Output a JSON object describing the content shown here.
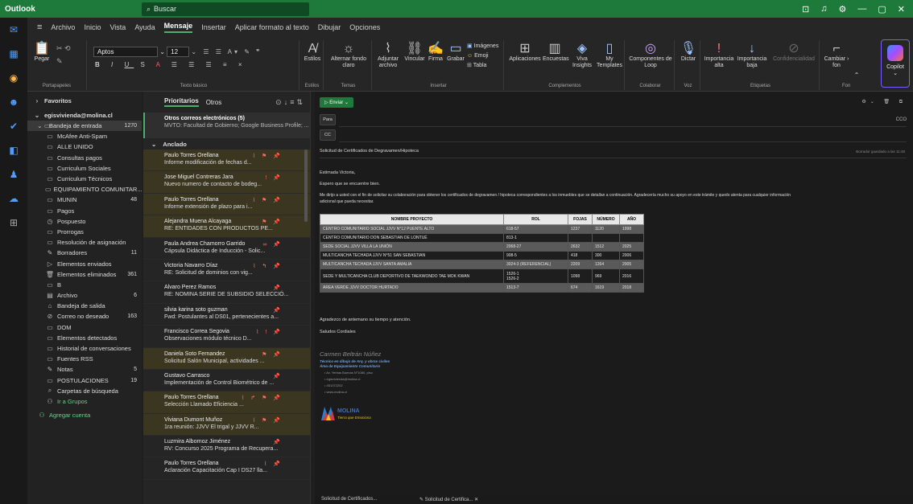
{
  "app": {
    "title": "Outlook",
    "search_placeholder": "Buscar"
  },
  "menu": [
    "Archivo",
    "Inicio",
    "Vista",
    "Ayuda",
    "Mensaje",
    "Insertar",
    "Aplicar formato al texto",
    "Dibujar",
    "Opciones"
  ],
  "ribbon": {
    "pegar": "Pegar",
    "portapapeles": "Portapapeles",
    "font_name": "Aptos",
    "font_size": "12",
    "texto_basico": "Texto básico",
    "estilos": "Estilos",
    "estilos_cap": "Estilos",
    "alternar1": "Alternar fondo",
    "alternar2": "claro",
    "temas": "Temas",
    "adjuntar1": "Adjuntar",
    "adjuntar2": "archivo",
    "vincular": "Vincular",
    "firma": "Firma",
    "grabar": "Grabar",
    "imagenes": "Imágenes",
    "emoji": "Emoji",
    "tabla": "Tabla",
    "insertar": "Insertar",
    "aplicaciones": "Aplicaciones",
    "encuestas": "Encuestas",
    "viva1": "Viva",
    "viva2": "Insights",
    "my1": "My",
    "my2": "Templates",
    "complementos": "Complementos",
    "loop1": "Componentes de",
    "loop2": "Loop",
    "colaborar": "Colaborar",
    "dictar": "Dictar",
    "voz": "Voz",
    "imp_alta1": "Importancia",
    "imp_alta2": "alta",
    "imp_baja1": "Importancia",
    "imp_baja2": "baja",
    "confidencialidad": "Confidencialidad",
    "etiquetas": "Etiquetas",
    "cambiar1": "Cambiar",
    "cambiar2": "fon",
    "fon_cap": "Fon",
    "copilot": "Copilot"
  },
  "folders": {
    "favoritos": "Favoritos",
    "account": "egisvivienda@molina.cl",
    "items": [
      {
        "label": "Bandeja de entrada",
        "count": "1270"
      },
      {
        "label": "McAfee Anti-Spam",
        "count": ""
      },
      {
        "label": "ALLE UNIDO",
        "count": ""
      },
      {
        "label": "Consultas pagos",
        "count": ""
      },
      {
        "label": "Curriculum Sociales",
        "count": ""
      },
      {
        "label": "Curriculum Técnicos",
        "count": ""
      },
      {
        "label": "EQUIPAMIENTO COMUNITAR...",
        "count": ""
      },
      {
        "label": "MUNIN",
        "count": "48"
      },
      {
        "label": "Pagos",
        "count": ""
      },
      {
        "label": "Pospuesto",
        "count": ""
      },
      {
        "label": "Prorrogas",
        "count": ""
      },
      {
        "label": "Resolución de asignación",
        "count": ""
      },
      {
        "label": "Borradores",
        "count": "11"
      },
      {
        "label": "Elementos enviados",
        "count": ""
      },
      {
        "label": "Elementos eliminados",
        "count": "361"
      },
      {
        "label": "B",
        "count": ""
      },
      {
        "label": "Archivo",
        "count": "6"
      },
      {
        "label": "Bandeja de salida",
        "count": ""
      },
      {
        "label": "Correo no deseado",
        "count": "163"
      },
      {
        "label": "DOM",
        "count": ""
      },
      {
        "label": "Elementos detectados",
        "count": ""
      },
      {
        "label": "Historial de conversaciones",
        "count": ""
      },
      {
        "label": "Fuentes RSS",
        "count": ""
      },
      {
        "label": "Notas",
        "count": "5"
      },
      {
        "label": "POSTULACIONES",
        "count": "19"
      },
      {
        "label": "Carpetas de búsqueda",
        "count": ""
      },
      {
        "label": "Ir a Grupos",
        "count": ""
      }
    ],
    "agregar": "Agregar cuenta"
  },
  "maillist": {
    "tab_prioritarios": "Prioritarios",
    "tab_otros": "Otros",
    "otros_title": "Otros correos electrónicos (5)",
    "otros_sub": "MVTO: Facultad de Gobierno; Google Business Profile; ...",
    "anclado": "Anclado",
    "items": [
      {
        "sender": "Paulo Torres Orellana",
        "subject": "Informe modificación de fechas d...",
        "y": true
      },
      {
        "sender": "Jose Miguel Contreras Jara",
        "subject": "Nuevo numero de contacto de bodeg...",
        "y": true
      },
      {
        "sender": "Paulo Torres Orellana",
        "subject": "Informe extensión de plazo para i...",
        "y": true
      },
      {
        "sender": "Alejandra Muena Alcayaga",
        "subject": "RE: ENTIDADES CON PRODUCTOS PE...",
        "y": true
      },
      {
        "sender": "Paula Andrea Chamorro Garrido",
        "subject": "Cápsula Didáctica de Inducción - Solic...",
        "y": false
      },
      {
        "sender": "Victoria Navarro Díaz",
        "subject": "RE: Solicitud de dominios con vig...",
        "y": false
      },
      {
        "sender": "Alvaro Perez Ramos",
        "subject": "RE: NOMINA SERIE DE SUBSIDIO SELECCIÓ...",
        "y": false
      },
      {
        "sender": "silvia karina soto guzman",
        "subject": "Fwd: Postulantes al DS01, pertenecientes a...",
        "y": false
      },
      {
        "sender": "Francisco Correa Segovia",
        "subject": "Observaciones módulo técnico D...",
        "y": false
      },
      {
        "sender": "Daniela Soto Fernandez",
        "subject": "Solicitud Salón Municipal, actividades ...",
        "y": true
      },
      {
        "sender": "Gustavo Carrasco",
        "subject": "Implementación de Control Biométrico de ...",
        "y": false
      },
      {
        "sender": "Paulo Torres Orellana",
        "subject": "Selección Llamado Eficiencia ...",
        "y": true
      },
      {
        "sender": "Viviana Dumont Muñoz",
        "subject": "1ra reunión: JJVV El trigal y JJVV R...",
        "y": true
      },
      {
        "sender": "Luzmira Albornoz Jiménez",
        "subject": "RV: Concurso 2025 Programa de Recupera...",
        "y": false
      },
      {
        "sender": "Paulo Torres Orellana",
        "subject": "Aclaración Capacitación Cap I DS27 lla...",
        "y": false
      }
    ]
  },
  "compose": {
    "send": "Enviar",
    "para": "Para",
    "cc": "CC",
    "cco": "CCO",
    "subject": "Solicitud de Certificados de Degravamen/Hipoteca",
    "draft_saved": "Borrador guardado a las 11:48",
    "greeting": "Estimada Victoria,",
    "line1": "Espero que se encuentre bien.",
    "line2": "Me dirijo a usted con el fin de solicitar su colaboración para obtener los certificados de degravamen / hipoteca correspondientes a los inmuebles que se detallan a continuación. Agradecería mucho su apoyo en este trámite y quedo atenta para cualquier información",
    "line3": "adicional que pueda necesitar.",
    "table_headers": [
      "NOMBRE PROYECTO",
      "ROL",
      "FOJAS",
      "NÚMERO",
      "AÑO"
    ],
    "table_rows": [
      [
        "CENTRO COMUNITARIO SOCIAL JJVV N°12 PUENTE ALTO",
        "618-57",
        "1237",
        "1120",
        "1998"
      ],
      [
        "CENTRO COMUNITARIO DON SEBASTIAN DE LONTUÉ",
        "813-1",
        "",
        "",
        ""
      ],
      [
        "SEDE SOCIAL JJVV VILLA LA UNIÓN",
        "2068-27",
        "2632",
        "1512",
        "2025"
      ],
      [
        "MULTICANCHA TECHADA JJVV N°51 SAN SEBASTIAN",
        "908-5",
        "418",
        "300",
        "2006"
      ],
      [
        "MULTICANCHA TECHADA JJVV SANTA AMALIA",
        "3024-3 (REFERENCIAL)",
        "2209",
        "1264",
        "2005"
      ],
      [
        "SEDE Y MULTICANCHA CLUB DEPORTIVO DE TAEKWONDO TAE MOK KWAN",
        "1526-1\n1526-2",
        "1098",
        "969",
        "2016"
      ],
      [
        "AREA VERDE JJVV DOCTOR HURTADO",
        "1513-7",
        "674",
        "1619",
        "2018"
      ]
    ],
    "thanks": "Agradezco de antemano su tiempo y atención.",
    "regards": "Saludos Cordiales",
    "sig_name": "Carmen Beltrán Núñez",
    "sig_role1": "Técnico en dibujo de Arq. y obras civiles",
    "sig_role2": "Área de Equipamiento Comunitario",
    "sig_addr": "Av. Yerbas Buenas N°1080, piso",
    "sig_mail": "egisvivienda@molina.cl",
    "sig_phone": "451372202",
    "sig_web": "www.molina.cl",
    "logo_text": "MOLINA",
    "logo_tag": "Tierra que Emociona"
  },
  "bottom_tabs": [
    "Solicitud de Certificados...",
    "Solicitud de Certifica..."
  ]
}
